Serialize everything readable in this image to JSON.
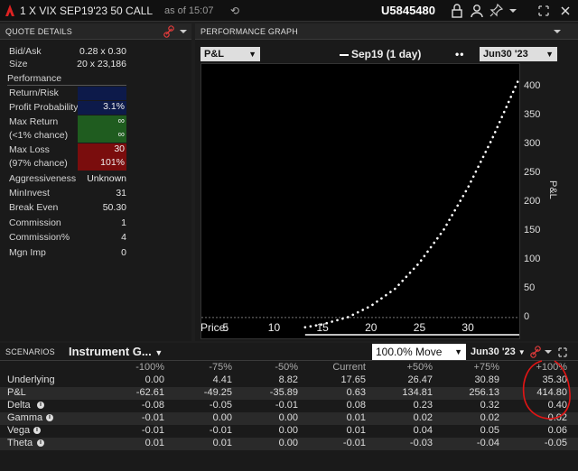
{
  "titlebar": {
    "title": "1 X VIX SEP19'23 50 CALL",
    "as_of": "as of 15:07",
    "account": "U5845480"
  },
  "quote_panel": {
    "header": "QUOTE DETAILS",
    "bid_ask_label": "Bid/Ask",
    "bid_ask_value": "0.28 x 0.30",
    "size_label": "Size",
    "size_value": "20 x 23,186",
    "performance_label": "Performance",
    "return_risk_label": "Return/Risk",
    "return_risk_value": "",
    "profit_prob_label": "Profit Probability",
    "profit_prob_value": "3.1%",
    "max_return_label": "Max Return",
    "max_return_sub": "(<1% chance)",
    "max_return_value": "∞",
    "max_return_sub_value": "∞",
    "max_loss_label": "Max Loss",
    "max_loss_sub": "(97% chance)",
    "max_loss_value": "30",
    "max_loss_sub_value": "101%",
    "rows": [
      {
        "label": "Aggressiveness",
        "value": "Unknown"
      },
      {
        "label": "MinInvest",
        "value": "31"
      },
      {
        "label": "Break Even",
        "value": "50.30"
      },
      {
        "label": "Commission",
        "value": "1"
      },
      {
        "label": "Commission%",
        "value": "4"
      },
      {
        "label": "Mgn Imp",
        "value": "0"
      }
    ]
  },
  "graph_panel": {
    "header": "PERFORMANCE GRAPH",
    "metric_select": "P&L",
    "legend_solid": "Sep19 (1 day)",
    "legend_dotted_select": "Jun30 '23",
    "y_axis_label": "P&L",
    "price_label": "Price:"
  },
  "chart_data": {
    "type": "line",
    "xlabel": "Price:",
    "ylabel": "P&L",
    "x_ticks": [
      "5",
      "10",
      "15",
      "20",
      "25",
      "30"
    ],
    "y_ticks": [
      "0",
      "50",
      "100",
      "150",
      "200",
      "250",
      "300",
      "350",
      "400"
    ],
    "xlim": [
      2.5,
      35.3
    ],
    "ylim": [
      -30,
      430
    ],
    "series": [
      {
        "name": "Sep19 (1 day)",
        "style": "solid",
        "color": "#ffffff",
        "x": [
          13.2,
          35.3
        ],
        "y": [
          -30,
          -30
        ]
      },
      {
        "name": "Jun30 '23",
        "style": "dotted",
        "color": "#ffffff",
        "x": [
          13.2,
          15,
          17.65,
          20,
          22.5,
          25,
          27.5,
          30,
          32.5,
          35.3
        ],
        "y": [
          -17,
          -12,
          0.6,
          20,
          50,
          95,
          152,
          225,
          310,
          415
        ]
      }
    ]
  },
  "scenarios": {
    "header": "SCENARIOS",
    "instrument_select": "Instrument G...",
    "move_select": "100.0% Move",
    "date_select": "Jun30 '23",
    "columns": [
      "-100%",
      "-75%",
      "-50%",
      "Current",
      "+50%",
      "+75%",
      "+100%"
    ],
    "rows": [
      {
        "label": "Underlying",
        "values": [
          "0.00",
          "4.41",
          "8.82",
          "17.65",
          "26.47",
          "30.89",
          "35.30"
        ]
      },
      {
        "label": "P&L",
        "values": [
          "-62.61",
          "-49.25",
          "-35.89",
          "0.63",
          "134.81",
          "256.13",
          "414.80"
        ]
      },
      {
        "label": "Delta",
        "values": [
          "-0.08",
          "-0.05",
          "-0.01",
          "0.08",
          "0.23",
          "0.32",
          "0.40"
        ]
      },
      {
        "label": "Gamma",
        "values": [
          "-0.01",
          "0.00",
          "0.00",
          "0.01",
          "0.02",
          "0.02",
          "0.02"
        ]
      },
      {
        "label": "Vega",
        "values": [
          "-0.01",
          "-0.01",
          "0.00",
          "0.01",
          "0.04",
          "0.05",
          "0.06"
        ]
      },
      {
        "label": "Theta",
        "values": [
          "0.01",
          "0.01",
          "0.00",
          "-0.01",
          "-0.03",
          "-0.04",
          "-0.05"
        ]
      }
    ]
  },
  "colors": {
    "accent_red": "#e23b3b",
    "return_cell_green": "#1f5c1f",
    "loss_cell_red": "#7a0d0d",
    "return_risk_blue": "#0d1a4a",
    "profit_prob_blue": "#0d1a4a"
  },
  "icons": [
    "ib-logo-icon",
    "refresh-icon",
    "lock-icon",
    "person-icon",
    "pin-icon",
    "chevron-down-icon",
    "restore-icon",
    "close-icon",
    "link-icon",
    "info-icon"
  ]
}
